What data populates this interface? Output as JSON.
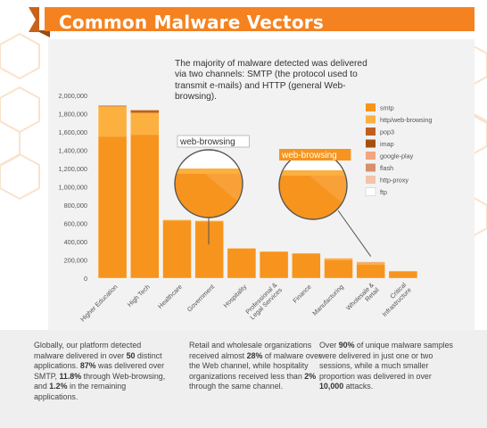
{
  "header": {
    "title": "Common Malware Vectors"
  },
  "intro": {
    "text": "The majority of malware detected was delivered via two channels: SMTP (the protocol used to transmit e-mails) and HTTP (general Web-browsing)."
  },
  "callouts": [
    {
      "label": "web-browsing"
    },
    {
      "label": "web-browsing"
    }
  ],
  "colors": {
    "banner": "#f58220",
    "smtp": "#f7941d",
    "http/web-browsing": "#fbb040",
    "pop3": "#c1601c",
    "imap": "#a64f0e",
    "google-play": "#f4a582",
    "flash": "#d9906a",
    "http-proxy": "#f2c4a8",
    "ftp": "#ffffff"
  },
  "chart_data": {
    "type": "bar",
    "stacked": true,
    "categories": [
      "Higher Education",
      "High Tech",
      "Healthcare",
      "Government",
      "Hospitality",
      "Professional & Legal Services",
      "Finance",
      "Manufacturing",
      "Wholesale & Retail",
      "Critical Infrastructure"
    ],
    "series": [
      {
        "name": "smtp",
        "values": [
          1550000,
          1570000,
          630000,
          620000,
          325000,
          290000,
          270000,
          195000,
          150000,
          75000
        ]
      },
      {
        "name": "http/web-browsing",
        "values": [
          330000,
          240000,
          10000,
          10000,
          5000,
          5000,
          5000,
          20000,
          20000,
          5000
        ]
      },
      {
        "name": "pop3",
        "values": [
          10000,
          30000,
          0,
          0,
          0,
          0,
          0,
          0,
          0,
          0
        ]
      },
      {
        "name": "imap",
        "values": [
          0,
          0,
          0,
          0,
          0,
          0,
          0,
          0,
          0,
          0
        ]
      },
      {
        "name": "google-play",
        "values": [
          0,
          0,
          0,
          0,
          0,
          0,
          0,
          5000,
          10000,
          0
        ]
      },
      {
        "name": "flash",
        "values": [
          0,
          0,
          0,
          0,
          0,
          0,
          0,
          0,
          0,
          0
        ]
      },
      {
        "name": "http-proxy",
        "values": [
          0,
          0,
          0,
          0,
          0,
          0,
          0,
          0,
          0,
          0
        ]
      },
      {
        "name": "ftp",
        "values": [
          0,
          0,
          0,
          0,
          0,
          0,
          0,
          0,
          0,
          0
        ]
      }
    ],
    "yticks": [
      "0",
      "200,000",
      "400,000",
      "600,000",
      "800,000",
      "1,000,000",
      "1,200,000",
      "1,400,000",
      "1,600,000",
      "1,800,000",
      "2,000,000"
    ],
    "ylim": [
      0,
      2000000
    ],
    "legend_position": "right",
    "grid": false
  },
  "footer": {
    "col1": {
      "p1": "Globally, our platform detected malware delivered in over ",
      "b1": "50",
      "p2": " distinct applications. ",
      "b2": "87%",
      "p3": " was delivered over SMTP, ",
      "b3": "11.8%",
      "p4": " through Web-browsing, and ",
      "b4": "1.2%",
      "p5": " in the remaining applications."
    },
    "col2": {
      "p1": "Retail and wholesale organizations received almost ",
      "b1": "28%",
      "p2": " of malware over the Web channel, while hospitality organizations received less than ",
      "b2": "2%",
      "p3": " through the same channel."
    },
    "col3": {
      "p1": "Over ",
      "b1": "90%",
      "p2": " of unique malware samples were delivered in just one or two sessions, while a much smaller proportion was delivered in over ",
      "b2": "10,000",
      "p3": " attacks."
    }
  }
}
